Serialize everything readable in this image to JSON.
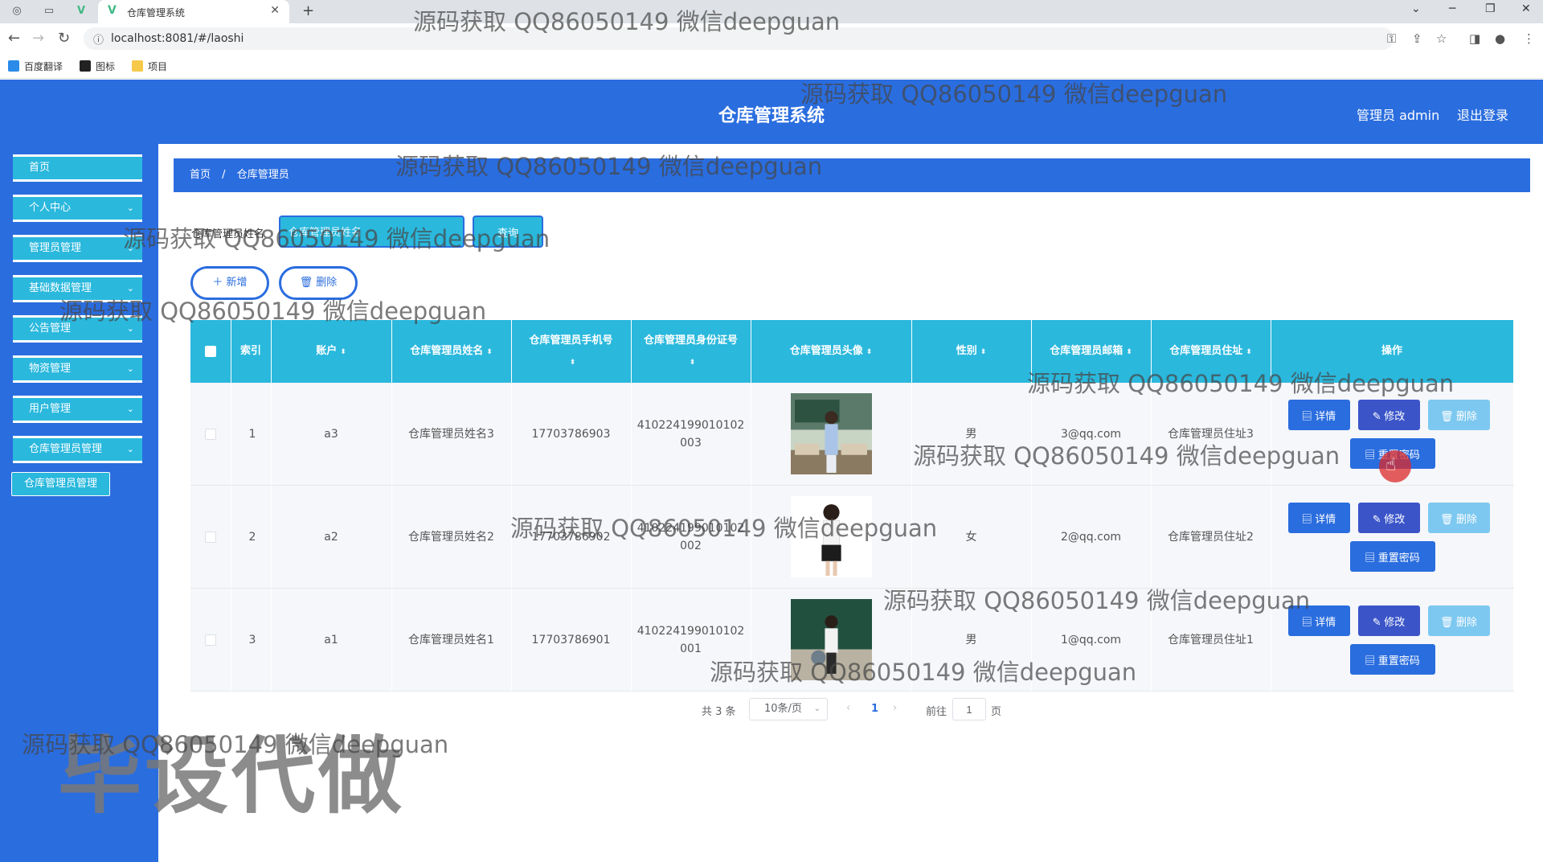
{
  "browser": {
    "tab_title": "仓库管理系统",
    "url": "localhost:8081/#/laoshi",
    "bookmarks": [
      "百度翻译",
      "图标",
      "项目"
    ]
  },
  "header": {
    "title": "仓库管理系统",
    "user": "管理员 admin",
    "logout": "退出登录"
  },
  "sidebar": {
    "items": [
      {
        "label": "首页",
        "chevron": false
      },
      {
        "label": "个人中心",
        "chevron": true
      },
      {
        "label": "管理员管理",
        "chevron": true
      },
      {
        "label": "基础数据管理",
        "chevron": true
      },
      {
        "label": "公告管理",
        "chevron": true
      },
      {
        "label": "物资管理",
        "chevron": true
      },
      {
        "label": "用户管理",
        "chevron": true
      },
      {
        "label": "仓库管理员管理",
        "chevron": true
      }
    ],
    "submenu": "仓库管理员管理"
  },
  "breadcrumb": [
    "首页",
    "/",
    "仓库管理员"
  ],
  "search": {
    "label": "仓库管理员姓名",
    "placeholder": "仓库管理员姓名",
    "button": "查询"
  },
  "actions": {
    "add": "＋ 新增",
    "delete": "🗑 删除"
  },
  "table": {
    "headers": [
      "",
      "索引",
      "账户",
      "仓库管理员姓名",
      "仓库管理员手机号",
      "仓库管理员身份证号",
      "仓库管理员头像",
      "性别",
      "仓库管理员邮箱",
      "仓库管理员住址",
      "操作"
    ],
    "rows": [
      {
        "index": "1",
        "account": "a3",
        "name": "仓库管理员姓名3",
        "phone": "17703786903",
        "idcard": "410224199010102003",
        "gender": "男",
        "email": "3@qq.com",
        "address": "仓库管理员住址3"
      },
      {
        "index": "2",
        "account": "a2",
        "name": "仓库管理员姓名2",
        "phone": "17703786902",
        "idcard": "410224199010102002",
        "gender": "女",
        "email": "2@qq.com",
        "address": "仓库管理员住址2"
      },
      {
        "index": "3",
        "account": "a1",
        "name": "仓库管理员姓名1",
        "phone": "17703786901",
        "idcard": "410224199010102001",
        "gender": "男",
        "email": "1@qq.com",
        "address": "仓库管理员住址1"
      }
    ],
    "ops": {
      "detail": "▤ 详情",
      "edit": "✎ 修改",
      "delete": "🗑 删除",
      "reset": "▤ 重置密码"
    }
  },
  "pagination": {
    "total": "共 3 条",
    "page_size": "10条/页",
    "current": "1",
    "goto": "前往",
    "goto_value": "1",
    "unit": "页"
  },
  "overlay": {
    "watermark": "源码获取 QQ86050149 微信deepguan",
    "big_watermark": "毕设代做"
  },
  "colors": {
    "header_blue": "#2a6ddf",
    "cyan": "#2ab8dd",
    "edit_purple": "#3b55c9",
    "delete_light": "#7dc8f0"
  }
}
